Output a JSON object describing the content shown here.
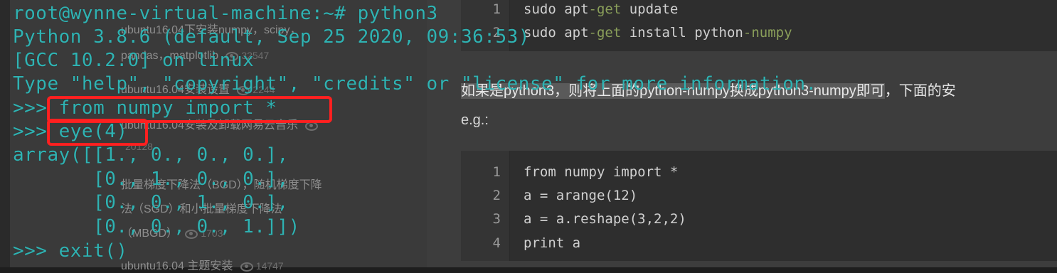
{
  "background_page": {
    "code_block_1": [
      {
        "num": "1",
        "pre": "sudo apt",
        "kw": "-get",
        "post": " update"
      },
      {
        "num": "2",
        "pre": "sudo apt",
        "kw": "-get",
        "post": " install python",
        "kw2": "-numpy"
      }
    ],
    "sentence_highlight": "如果是python3，则将上面的python-numpy换成python3-numpy即可",
    "sentence_rest": "，下面的安",
    "eg_label": "e.g.:",
    "code_block_2": [
      {
        "num": "1",
        "code": "from numpy import *"
      },
      {
        "num": "2",
        "code": "a = arange(12)"
      },
      {
        "num": "3",
        "code": "a = a.reshape(3,2,2)"
      },
      {
        "num": "4",
        "code": "print a"
      }
    ],
    "sidebar_items": [
      {
        "title": "ubuntu16.04下安装numpy，scipy，",
        "title2": "pandas，matplotlib",
        "views": "32547"
      },
      {
        "title": "ubuntu16.04安装设置",
        "views": "2244"
      },
      {
        "title": "ubuntu16.04安装及卸载网易云音乐",
        "views": "20128"
      },
      {
        "title": "批量梯度下降法（BGD），随机梯度下降",
        "title2": "法（SGD）和小批量梯度下降法",
        "title3": "（MBGD）",
        "views": "1703"
      },
      {
        "title": "ubuntu16.04 主题安装",
        "views": "14747"
      }
    ]
  },
  "terminal": {
    "lines": [
      "root@wynne-virtual-machine:~# python3",
      "Python 3.8.6 (default, Sep 25 2020, 09:36:53)",
      "[GCC 10.2.0] on linux",
      "Type \"help\", \"copyright\", \"credits\" or \"license\" for more information.",
      ">>> from numpy import *",
      ">>> eye(4)",
      "array([[1., 0., 0., 0.],",
      "       [0., 1., 0., 0.],",
      "       [0., 0., 1., 0.],",
      "       [0., 0., 0., 1.]])",
      ">>> exit()"
    ]
  },
  "colors": {
    "terminal_text": "#2fb3b3",
    "annotation_box": "#ff2020"
  }
}
